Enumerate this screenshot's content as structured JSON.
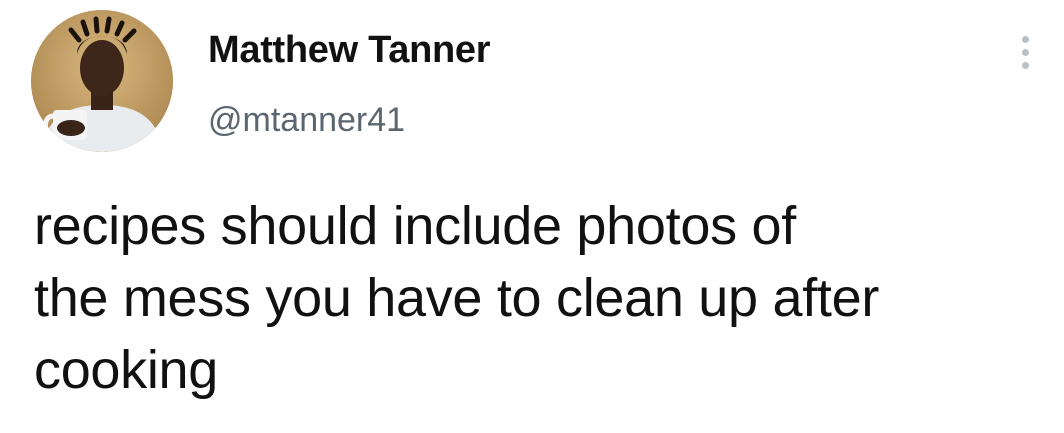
{
  "tweet": {
    "author": {
      "display_name": "Matthew Tanner",
      "handle": "@mtanner41"
    },
    "text_lines": [
      "recipes should include photos of",
      "the mess you have to clean up after",
      "cooking"
    ],
    "more_icon": "more-vertical-icon"
  },
  "colors": {
    "text": "#111111",
    "handle": "#5b6670",
    "more_dots": "#b8c0c7",
    "background": "#ffffff"
  }
}
